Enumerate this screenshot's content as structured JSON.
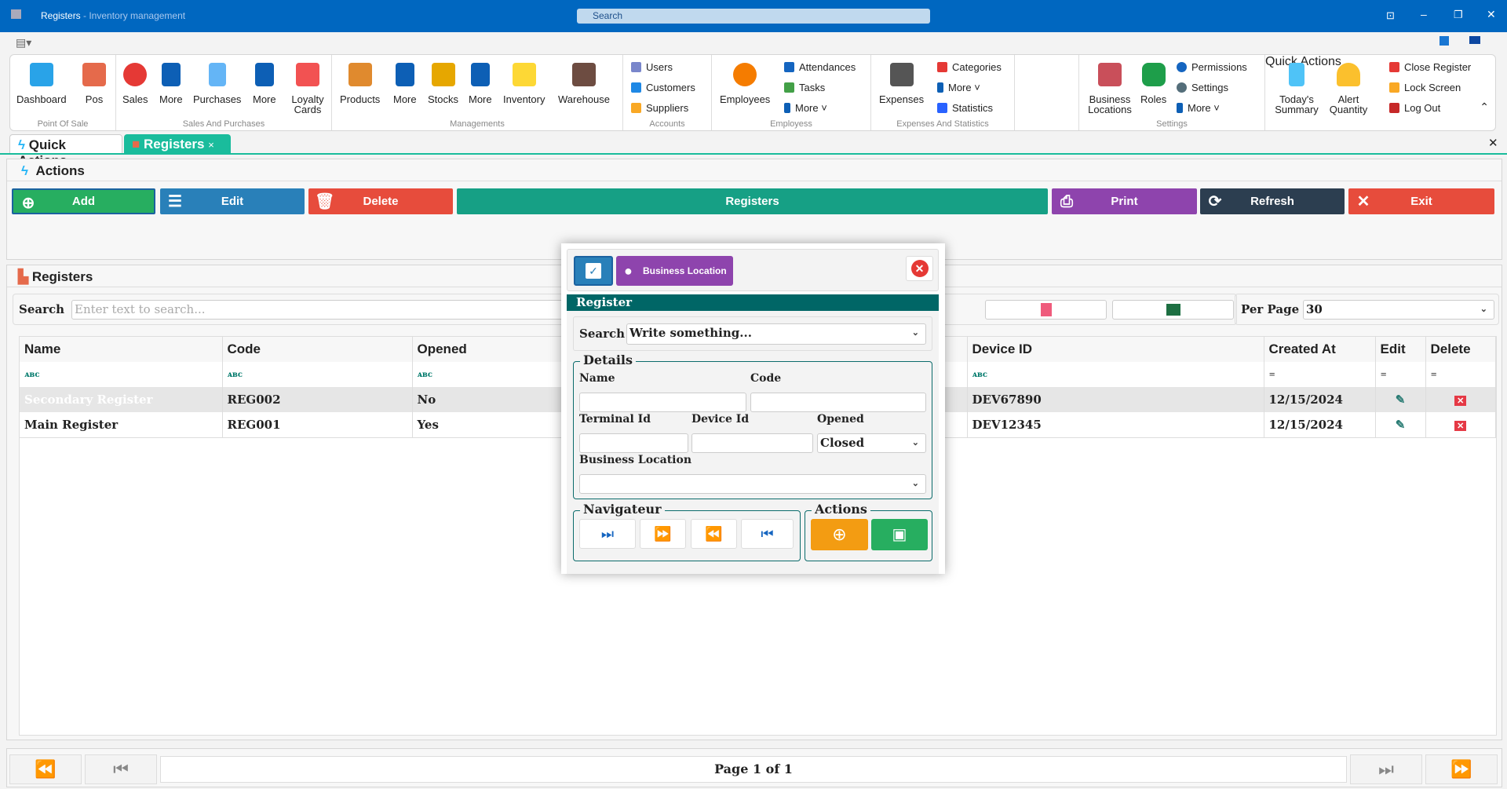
{
  "window": {
    "title": "Registers",
    "subtitle": " - Inventory management",
    "search_placeholder": "Search"
  },
  "ribbon": {
    "groups": [
      "Point Of Sale",
      "Sales And Purchases",
      "Managements",
      "Accounts",
      "Employess",
      "Expenses And Statistics",
      "",
      "Settings",
      "Quick Actions"
    ],
    "dashboard": "Dashboard",
    "pos": "Pos",
    "sales": "Sales",
    "more": "More",
    "purchases": "Purchases",
    "loyalty": "Loyalty Cards",
    "products": "Products",
    "stocks": "Stocks",
    "inventory": "Inventory",
    "warehouse": "Warehouse",
    "users": "Users",
    "customers": "Customers",
    "suppliers": "Suppliers",
    "employees": "Employees",
    "attendances": "Attendances",
    "tasks": "Tasks",
    "more_dd": "More ˅",
    "expenses": "Expenses",
    "categories": "Categories",
    "statistics": "Statistics",
    "business_locations": "Business Locations",
    "roles": "Roles",
    "permissions": "Permissions",
    "settings": "Settings",
    "todays_summary": "Today's Summary",
    "alert_quantity": "Alert Quantity",
    "close_register": "Close Register",
    "lock_screen": "Lock Screen",
    "log_out": "Log Out"
  },
  "tabs": [
    {
      "label": "Quick Actions"
    },
    {
      "label": "Registers",
      "close": "×"
    }
  ],
  "actions": {
    "title": "Actions",
    "buttons": [
      "Add",
      "Edit",
      "Delete",
      "Registers",
      "Print",
      "Refresh",
      "Exit"
    ],
    "colors": [
      "#27ae60",
      "#2980b9",
      "#e74c3c",
      "#16a085",
      "#8e44ad",
      "#2c3e50",
      "#e74c3c"
    ]
  },
  "registers": {
    "title": "Registers",
    "search_label": "Search",
    "search_placeholder": "Enter text to search...",
    "per_page_label": "Per Page",
    "per_page": "30",
    "columns": [
      "Name",
      "Code",
      "Opened",
      "Device ID",
      "Created At",
      "Edit",
      "Delete"
    ],
    "rows": [
      {
        "name": "Secondary Register",
        "code": "REG002",
        "opened": "No",
        "device": "DEV67890",
        "created": "12/15/2024"
      },
      {
        "name": "Main Register",
        "code": "REG001",
        "opened": "Yes",
        "device": "DEV12345",
        "created": "12/15/2024"
      }
    ],
    "page": "Page 1 of 1"
  },
  "modal": {
    "business_location_btn": "Business Location",
    "header": "Register",
    "search_label": "Search",
    "search_value": "Write something...",
    "details": "Details",
    "name": "Name",
    "code": "Code",
    "terminal_id": "Terminal Id",
    "device_id": "Device Id",
    "opened": "Opened",
    "opened_value": "Closed",
    "business_location": "Business Location",
    "navigator": "Navigateur",
    "actions": "Actions"
  }
}
